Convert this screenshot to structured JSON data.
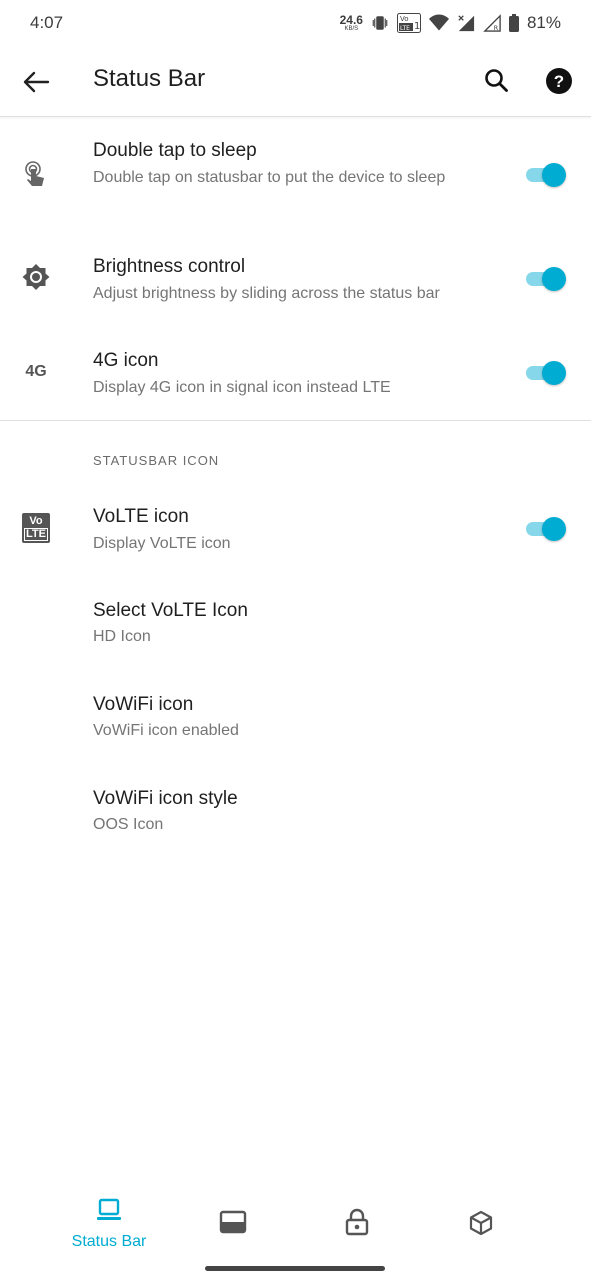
{
  "status_bar": {
    "time": "4:07",
    "net_speed": "24.6",
    "net_unit": "KB/S",
    "volte_badge": "Vo LTE 1",
    "roaming_letter": "R",
    "battery": "81%"
  },
  "app_bar": {
    "title": "Status Bar",
    "back_icon": "arrow-back-icon",
    "search_icon": "search-icon",
    "help_icon": "help-icon"
  },
  "settings": [
    {
      "title": "Double tap to sleep",
      "summary": "Double tap on statusbar to put the device to sleep",
      "icon": "touch-icon",
      "toggle_on": true
    },
    {
      "title": "Brightness control",
      "summary": "Adjust brightness by sliding across the status bar",
      "icon": "brightness-icon",
      "toggle_on": true
    },
    {
      "title": "4G icon",
      "summary": "Display 4G icon in signal icon instead LTE",
      "icon": "4g-icon",
      "icon_text": "4G",
      "toggle_on": true
    }
  ],
  "section": {
    "header": "STATUSBAR ICON",
    "items": [
      {
        "title": "VoLTE icon",
        "summary": "Display VoLTE icon",
        "icon": "volte-icon",
        "icon_text_top": "Vo",
        "icon_text_bottom": "LTE",
        "toggle_on": true
      },
      {
        "title": "Select VoLTE Icon",
        "summary": "HD Icon"
      },
      {
        "title": "VoWiFi icon",
        "summary": "VoWiFi icon enabled"
      },
      {
        "title": "VoWiFi icon style",
        "summary": "OOS Icon"
      }
    ]
  },
  "bottom_nav": {
    "items": [
      {
        "icon": "laptop-icon",
        "label": "Status Bar",
        "active": true
      },
      {
        "icon": "panel-icon",
        "label": "",
        "active": false
      },
      {
        "icon": "lock-icon",
        "label": "",
        "active": false
      },
      {
        "icon": "cube-icon",
        "label": "",
        "active": false
      }
    ]
  },
  "colors": {
    "accent": "#00acd1",
    "accent_track": "#86d7ea",
    "text_primary": "#1f1f1f",
    "text_secondary": "#757575"
  }
}
